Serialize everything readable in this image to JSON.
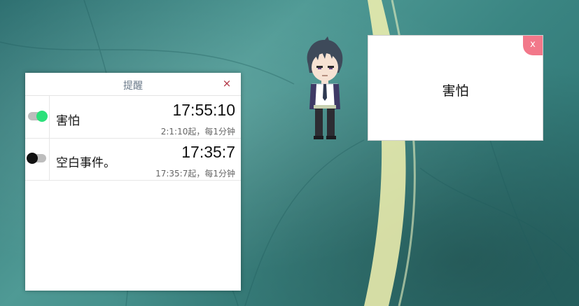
{
  "reminder_panel": {
    "title": "提醒",
    "close_symbol": "×",
    "items": [
      {
        "name": "害怕",
        "time": "17:55:10",
        "detail": "2:1:10起，每1分钟",
        "enabled": true
      },
      {
        "name": "空白事件。",
        "time": "17:35:7",
        "detail": "17:35:7起，每1分钟",
        "enabled": false
      }
    ]
  },
  "popup": {
    "message": "害怕",
    "close_label": "x"
  },
  "colors": {
    "toggle_on": "#2be07a",
    "toggle_off_knob": "#111111",
    "popup_close_bg": "#f2788a",
    "wallpaper": "#3f8a88"
  },
  "icons": {
    "panel_close": "close-icon",
    "mascot": "anime-character-mascot"
  }
}
